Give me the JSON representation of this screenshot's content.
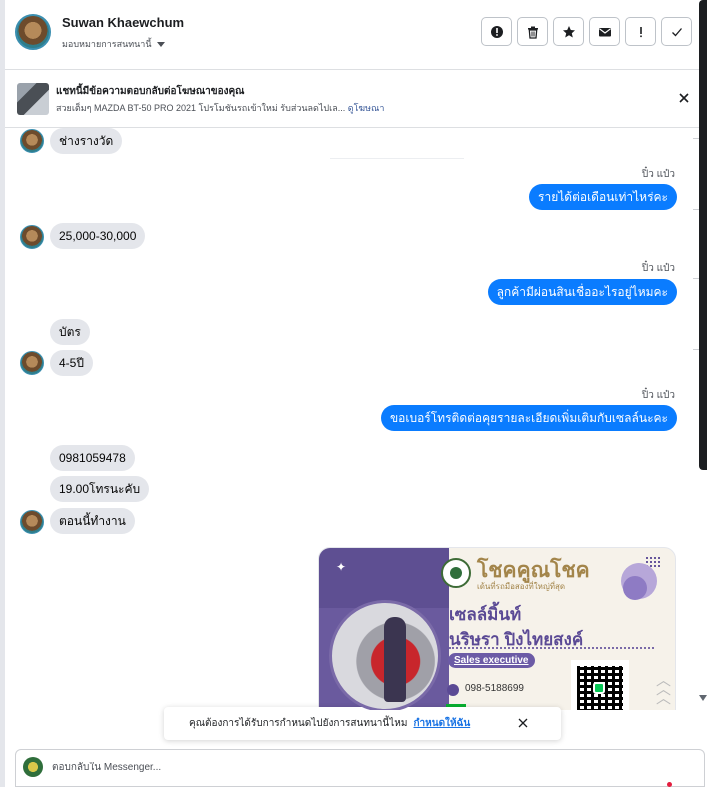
{
  "header": {
    "contact_name": "Suwan Khaewchum",
    "assign_label": "มอบหมายการสนทนานี้",
    "toolbar_icons": [
      "alert-circle-icon",
      "trash-icon",
      "star-icon",
      "envelope-icon",
      "exclamation-icon",
      "check-icon"
    ]
  },
  "ad_banner": {
    "title": "แชทนี้มีข้อความตอบกลับต่อโฆษณาของคุณ",
    "description": "สวยเต็มๆ MAZDA BT-50 PRO 2021 โปรโมชันรถเข้าใหม่ รับส่วนลดไปเล...",
    "link_label": "ดูโฆษณา"
  },
  "messages": [
    {
      "direction": "in",
      "text": "ช่างรางวัด",
      "avatar": true
    },
    {
      "direction": "out",
      "sender": "ปิ๋ว แป๋ว",
      "text": "รายได้ต่อเดือนเท่าไหร่คะ"
    },
    {
      "direction": "in",
      "text": "25,000-30,000",
      "avatar": true
    },
    {
      "direction": "out",
      "sender": "ปิ๋ว แป๋ว",
      "text": "ลูกค้ามีผ่อนสินเชื่ออะไรอยู่ไหมคะ"
    },
    {
      "direction": "in",
      "text": "บัตร",
      "avatar": false
    },
    {
      "direction": "in",
      "text": "4-5ปี",
      "avatar": true
    },
    {
      "direction": "out",
      "sender": "ปิ๋ว แป๋ว",
      "text": "ขอเบอร์โทรติดต่อคุยรายละเอียดเพิ่มเติมกับเซลล์นะคะ"
    },
    {
      "direction": "in",
      "text": "0981059478",
      "avatar": false
    },
    {
      "direction": "in",
      "text": "19.00โทรนะคับ",
      "avatar": false
    },
    {
      "direction": "in",
      "text": "ตอนนี้ทำงาน",
      "avatar": true
    }
  ],
  "card": {
    "brand": "โชคคูณโชค",
    "tagline": "เด้นที่รถมือสองที่ใหญ่ที่สุด",
    "role": "เซลล์มิ้นท์",
    "name": "นริษรา  ปิงไทยสงค์",
    "job_title": "Sales executive",
    "phone": "098-5188699"
  },
  "notice": {
    "text": "คุณต้องการได้รับการกำหนดไปยังการสนทนานี้ไหม",
    "link_label": "กำหนดให้ฉัน"
  },
  "reply": {
    "placeholder": "ตอบกลับใน Messenger..."
  },
  "colors": {
    "outgoing_bubble": "#0a7cff",
    "incoming_bubble": "#e4e6eb",
    "link": "#1b74e4"
  }
}
